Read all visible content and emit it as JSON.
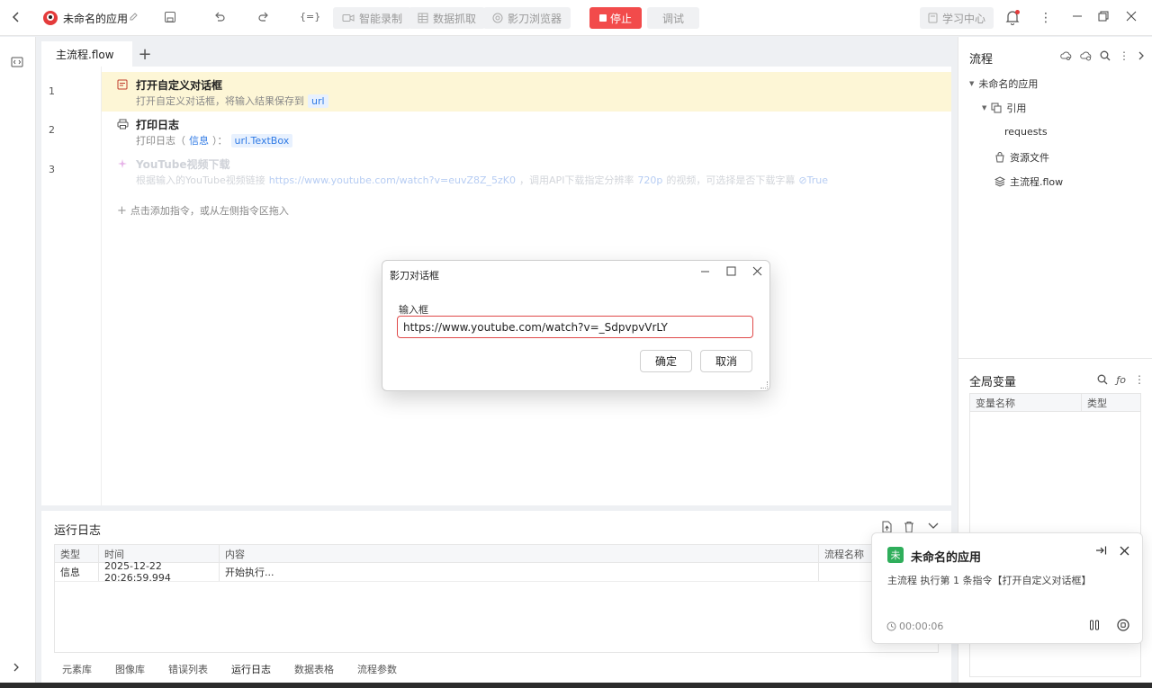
{
  "topbar": {
    "app_title": "未命名的应用",
    "smart_record": "智能录制",
    "data_capture": "数据抓取",
    "browser": "影刀浏览器",
    "stop_label": "停止",
    "debug_label": "调试",
    "study_label": "学习中心"
  },
  "editor": {
    "tab_label": "主流程.flow",
    "add_tab": "+",
    "lines": [
      {
        "num": "1",
        "title": "打开自定义对话框",
        "desc_prefix": "打开自定义对话框，将输入结果保存到",
        "chip": "url"
      },
      {
        "num": "2",
        "title": "打印日志",
        "desc_prefix": "打印日志（",
        "chip1": "信息",
        "desc_mid": "）：",
        "chip2": "url.TextBox"
      },
      {
        "num": "3",
        "title": "YouTube视频下载",
        "desc_prefix": "根据输入的YouTube视频链接",
        "link": "https://www.youtube.com/watch?v=euvZ8Z_5zK0",
        "desc_mid": "，调用API下载指定分辨率",
        "res": "720p",
        "desc_mid2": "的视频，可选择是否下载字幕",
        "flag": "True"
      }
    ],
    "add_hint": "点击添加指令，或从左侧指令区拖入"
  },
  "log": {
    "title": "运行日志",
    "columns": [
      "类型",
      "时间",
      "内容",
      "流程名称"
    ],
    "rows": [
      {
        "type": "信息",
        "time": "2025-12-22 20:26:59.994",
        "content": "开始执行..."
      }
    ],
    "bottom_tabs": [
      "元素库",
      "图像库",
      "错误列表",
      "运行日志",
      "数据表格",
      "流程参数"
    ],
    "active_tab": "运行日志"
  },
  "right_panel": {
    "title": "流程",
    "tree": {
      "root": "未命名的应用",
      "ref": "引用",
      "requests": "requests",
      "resources": "资源文件",
      "main_flow": "主流程.flow"
    },
    "globals_title": "全局变量",
    "globals_columns": [
      "变量名称",
      "类型"
    ]
  },
  "dialog": {
    "title": "影刀对话框",
    "label": "输入框",
    "value": "https://www.youtube.com/watch?v=_SdpvpvVrLY",
    "ok": "确定",
    "cancel": "取消"
  },
  "toast": {
    "badge": "未",
    "title": "未命名的应用",
    "message": "主流程 执行第 1 条指令【打开自定义对话框】",
    "time": "00:00:06"
  },
  "colors": {
    "accent_red": "#f24b4b",
    "chip_blue": "#2f7ae5",
    "highlight_row": "#fdf6d6",
    "toast_badge": "#2fae5b"
  }
}
